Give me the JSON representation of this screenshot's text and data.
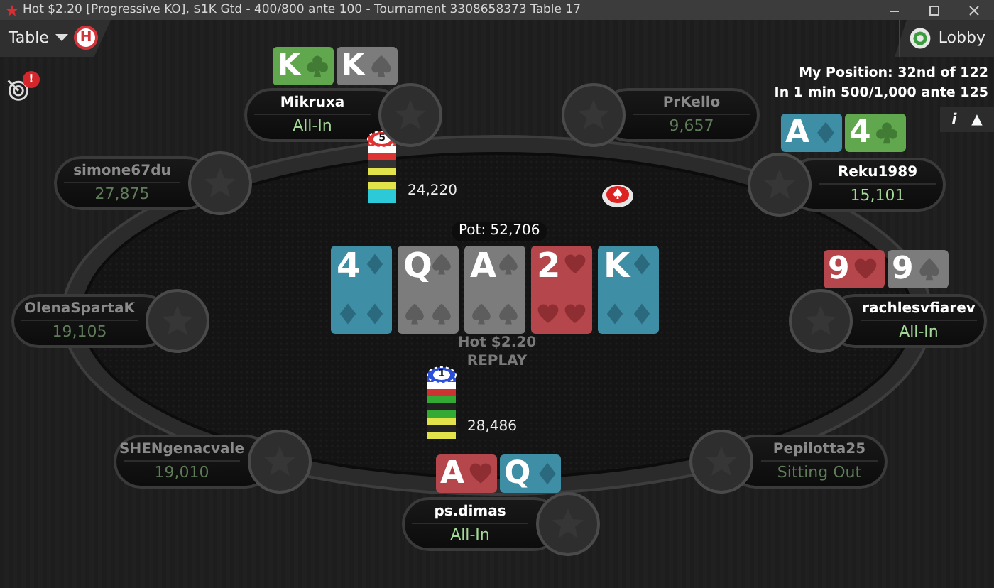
{
  "window": {
    "title": "Hot $2.20 [Progressive KO], $1K Gtd - 400/800 ante 100 - Tournament 3308658373 Table 17"
  },
  "toolbar": {
    "table_menu": "Table",
    "home_badge": "H",
    "lobby": "Lobby"
  },
  "alert_badge": "!",
  "tournament_info": [
    "My Position: 32nd of 122",
    "In 1 min 500/1,000 ante 125"
  ],
  "info_button": {
    "label": "i",
    "toggle": "▲"
  },
  "players": [
    {
      "name": "Mikruxa",
      "stack": "All-In",
      "folded": false,
      "cards": [
        {
          "rank": "K",
          "kind": "clubs"
        },
        {
          "rank": "K",
          "kind": "spades"
        }
      ]
    },
    {
      "name": "PrKello",
      "stack": "9,657",
      "folded": true
    },
    {
      "name": "simone67du",
      "stack": "27,875",
      "folded": true
    },
    {
      "name": "Reku1989",
      "stack": "15,101",
      "folded": false,
      "cards": [
        {
          "rank": "A",
          "kind": "diamonds"
        },
        {
          "rank": "4",
          "kind": "clubs"
        }
      ]
    },
    {
      "name": "OlenaSpartaK",
      "stack": "19,105",
      "folded": true
    },
    {
      "name": "rachlesvfiarev",
      "stack": "All-In",
      "folded": false,
      "cards": [
        {
          "rank": "9",
          "kind": "hearts"
        },
        {
          "rank": "9",
          "kind": "spades"
        }
      ]
    },
    {
      "name": "SHENgenacvale",
      "stack": "19,010",
      "folded": true
    },
    {
      "name": "Pepilotta25",
      "stack": "Sitting Out",
      "folded": true
    },
    {
      "name": "ps.dimas",
      "stack": "All-In",
      "folded": false,
      "cards": [
        {
          "rank": "A",
          "kind": "hearts"
        },
        {
          "rank": "Q",
          "kind": "diamonds"
        }
      ]
    }
  ],
  "bets": [
    {
      "chip": "5",
      "amount": "24,220"
    },
    {
      "chip": "1",
      "amount": "28,486"
    }
  ],
  "pot": "Pot: 52,706",
  "board": [
    {
      "rank": "4",
      "kind": "diamonds"
    },
    {
      "rank": "Q",
      "kind": "spades"
    },
    {
      "rank": "A",
      "kind": "spades"
    },
    {
      "rank": "2",
      "kind": "hearts"
    },
    {
      "rank": "K",
      "kind": "diamonds"
    }
  ],
  "table_name": "Hot $2.20",
  "replay": "REPLAY"
}
